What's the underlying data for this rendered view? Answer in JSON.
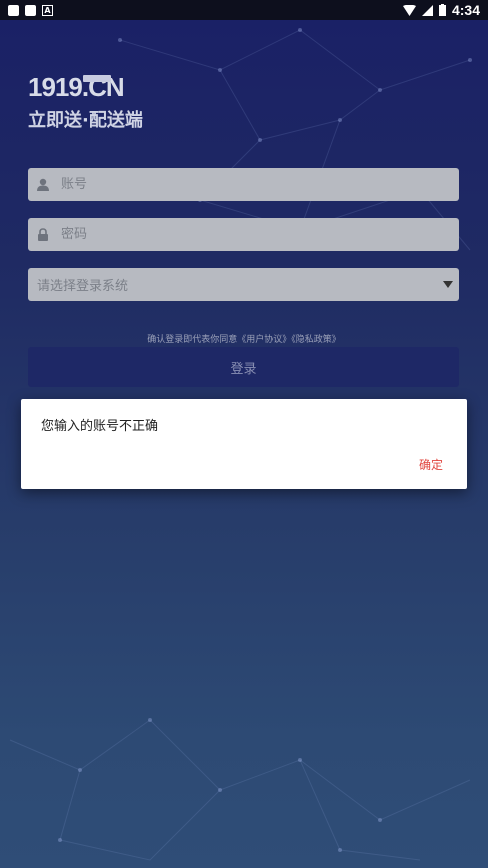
{
  "status_bar": {
    "time": "4:34"
  },
  "brand": {
    "logo_text": "1919.CN",
    "slogan": "立即送·配送端"
  },
  "form": {
    "account_placeholder": "账号",
    "password_placeholder": "密码",
    "system_select_label": "请选择登录系统",
    "agreement_text": "确认登录即代表你同意《用户协议》《隐私政策》",
    "login_label": "登录"
  },
  "dialog": {
    "message": "您输入的账号不正确",
    "confirm_label": "确定"
  },
  "colors": {
    "accent": "#e0453e",
    "button": "#1e2866",
    "field": "#b7bac1"
  },
  "icons": {
    "account": "user-icon",
    "password": "lock-icon",
    "select": "caret-down-icon"
  }
}
